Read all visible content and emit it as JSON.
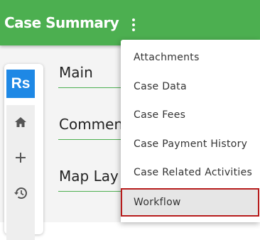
{
  "header": {
    "title": "Case Summary",
    "menu_icon": "more-vert-icon",
    "bg_color": "#4caf50"
  },
  "sidebar": {
    "logo_text": "Rs",
    "logo_color": "#1e88e5",
    "items": [
      {
        "icon": "home-icon"
      },
      {
        "icon": "plus-icon"
      },
      {
        "icon": "history-icon"
      }
    ]
  },
  "sections": [
    "Main",
    "Commen",
    "Map Lay"
  ],
  "menu": {
    "items": [
      {
        "label": "Attachments"
      },
      {
        "label": "Case Data"
      },
      {
        "label": "Case Fees"
      },
      {
        "label": "Case Payment History"
      },
      {
        "label": "Case Related Activities"
      },
      {
        "label": "Workflow",
        "selected": true
      }
    ],
    "selected_border_color": "#b71c1c"
  }
}
